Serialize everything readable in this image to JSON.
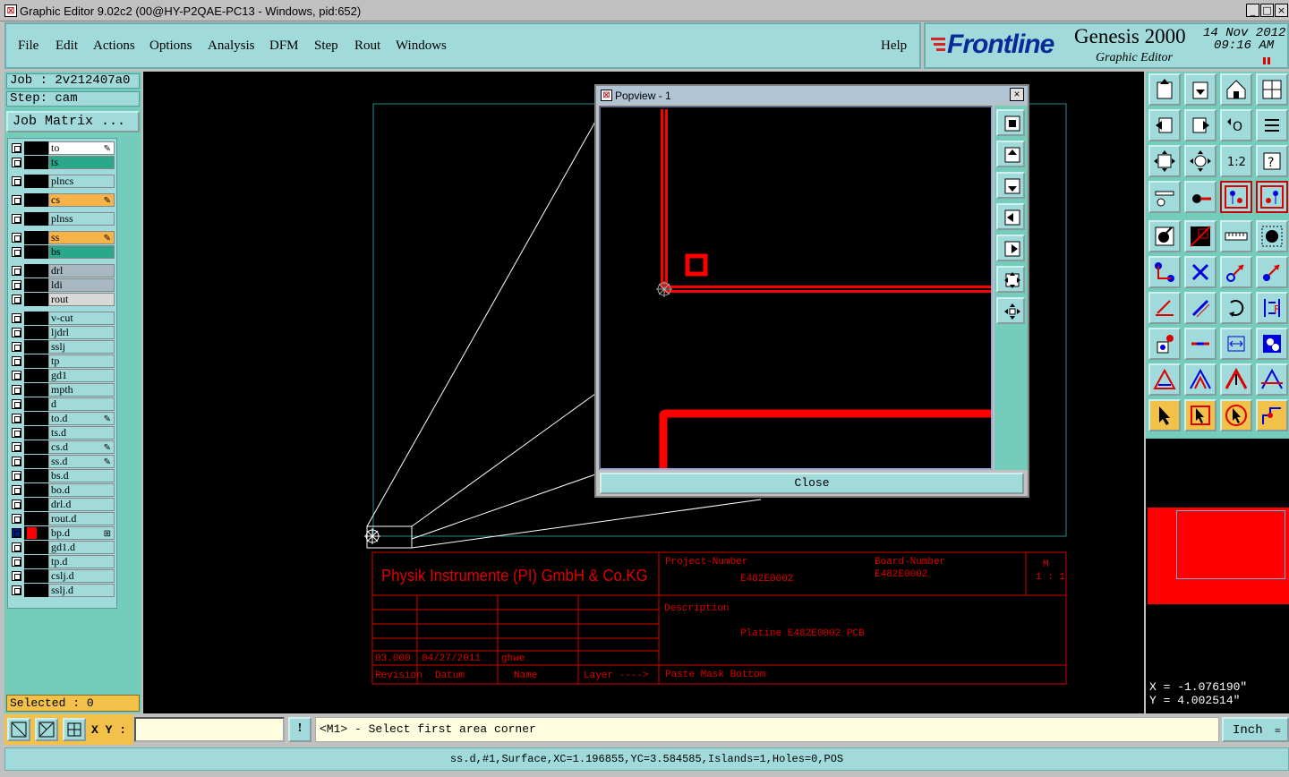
{
  "window": {
    "title": "Graphic Editor 9.02c2 (00@HY-P2QAE-PC13 - Windows, pid:652)",
    "minimize": "_",
    "maximize": "□",
    "close": "×"
  },
  "menu": {
    "file": "File",
    "edit": "Edit",
    "actions": "Actions",
    "options": "Options",
    "analysis": "Analysis",
    "dfm": "DFM",
    "step": "Step",
    "rout": "Rout",
    "windows": "Windows",
    "help": "Help"
  },
  "brand": {
    "logo": "Frontline",
    "product": "Genesis 2000",
    "subtitle": "Graphic Editor",
    "date": "14 Nov 2012",
    "time": "09:16 AM"
  },
  "job": {
    "job_line": "Job : 2v212407a0",
    "step_line": "Step: cam",
    "job_matrix": "Job Matrix ..."
  },
  "layers": [
    {
      "name": "to",
      "color": "#ffffff",
      "aff": true
    },
    {
      "name": "ts",
      "color": "#2aa88a",
      "aff": false
    },
    {
      "name": "plncs",
      "color": "#a0dada",
      "aff": false
    },
    {
      "name": "cs",
      "color": "#f6b34a",
      "aff": true
    },
    {
      "name": "plnss",
      "color": "#a0dada",
      "aff": false
    },
    {
      "name": "ss",
      "color": "#f6b34a",
      "aff": true
    },
    {
      "name": "bs",
      "color": "#2aa88a",
      "aff": false
    },
    {
      "name": "drl",
      "color": "#a8b8c0",
      "aff": false
    },
    {
      "name": "ldi",
      "color": "#a8b8c0",
      "aff": false
    },
    {
      "name": "rout",
      "color": "#d8d8d8",
      "aff": false
    },
    {
      "name": "v-cut",
      "color": "#a0dada",
      "aff": false
    },
    {
      "name": "ljdrl",
      "color": "#a0dada",
      "aff": false
    },
    {
      "name": "sslj",
      "color": "#a0dada",
      "aff": false
    },
    {
      "name": "tp",
      "color": "#a0dada",
      "aff": false
    },
    {
      "name": "gd1",
      "color": "#a0dada",
      "aff": false
    },
    {
      "name": "mpth",
      "color": "#a0dada",
      "aff": false
    },
    {
      "name": "d",
      "color": "#a0dada",
      "aff": false
    },
    {
      "name": "to.d",
      "color": "#a0dada",
      "aff": true
    },
    {
      "name": "ts.d",
      "color": "#a0dada",
      "aff": false
    },
    {
      "name": "cs.d",
      "color": "#a0dada",
      "aff": true
    },
    {
      "name": "ss.d",
      "color": "#a0dada",
      "aff": true
    },
    {
      "name": "bs.d",
      "color": "#a0dada",
      "aff": false
    },
    {
      "name": "bo.d",
      "color": "#a0dada",
      "aff": false
    },
    {
      "name": "drl.d",
      "color": "#a0dada",
      "aff": false
    },
    {
      "name": "rout.d",
      "color": "#a0dada",
      "aff": false
    },
    {
      "name": "bp.d",
      "color": "#a0dada",
      "aff": false,
      "active": true
    },
    {
      "name": "gd1.d",
      "color": "#a0dada",
      "aff": false
    },
    {
      "name": "tp.d",
      "color": "#a0dada",
      "aff": false
    },
    {
      "name": "cslj.d",
      "color": "#a0dada",
      "aff": false
    },
    {
      "name": "sslj.d",
      "color": "#a0dada",
      "aff": false
    }
  ],
  "selected": "Selected : 0",
  "popview": {
    "title": "Popview - 1",
    "close_button": "Close"
  },
  "titleblock": {
    "company": "Physik Instrumente (PI) GmbH & Co.KG",
    "project_label": "Project-Number",
    "project_value": "E482E0002",
    "board_label": "Board-Number",
    "board_value": "E482E0002",
    "m_label": "M",
    "m_value": "1 : 1",
    "description_label": "Description",
    "description_value": "Platine E482E0002 PCB",
    "revision_value": "03.000",
    "date_value": "04/27/2011",
    "name_value": "ghwe",
    "revision_label": "Revision",
    "datum_label": "Datum",
    "name_label": "Name",
    "layer_label": "Layer ---->",
    "layer_value": "Paste Mask Bottom"
  },
  "coords": {
    "x": "X = -1.076190\"",
    "y": "Y = 4.002514\""
  },
  "status": {
    "xy_label": "X Y :",
    "xy_value": "",
    "prompt": "<M1> - Select first area corner",
    "units": "Inch",
    "info": "ss.d,#1,Surface,XC=1.196855,YC=3.584585,Islands=1,Holes=0,POS"
  },
  "colors": {
    "accent": "#a0dada",
    "panel": "#74ccba",
    "feature": "#ff0000",
    "canvas": "#000000",
    "highlight": "#f2c14a"
  }
}
